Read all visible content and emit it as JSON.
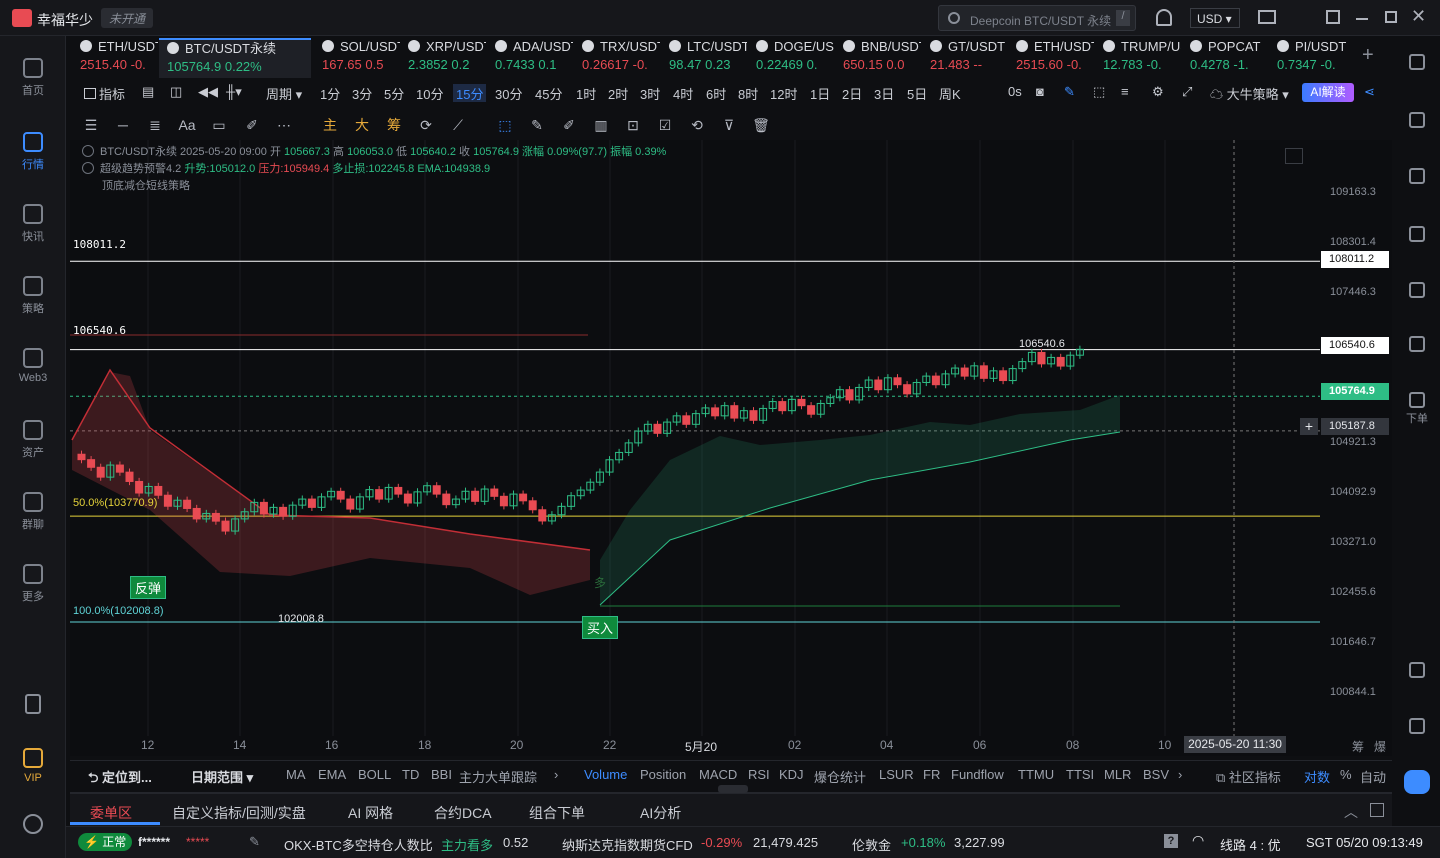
{
  "app": {
    "name": "幸福华少",
    "badge": "未开通",
    "search_placeholder": "Deepcoin BTC/USDT 永续",
    "search_shortcut": "/",
    "currency": "USD"
  },
  "sidebar": [
    {
      "label": "首页",
      "icon": "home-icon"
    },
    {
      "label": "行情",
      "icon": "chart-bar-icon"
    },
    {
      "label": "快讯",
      "icon": "news-icon"
    },
    {
      "label": "策略",
      "icon": "robot-icon"
    },
    {
      "label": "Web3",
      "icon": "web3-icon"
    },
    {
      "label": "资产",
      "icon": "wallet-icon"
    },
    {
      "label": "群聊",
      "icon": "chat-icon"
    },
    {
      "label": "更多",
      "icon": "grid-icon"
    },
    {
      "label": "VIP",
      "icon": "vip-diamond-icon"
    }
  ],
  "tabs": [
    {
      "name": "ETH/USDT",
      "price": "2515.40",
      "change": "-0.",
      "dir": "down"
    },
    {
      "name": "BTC/USDT永续",
      "price": "105764.9",
      "change": "0.22%",
      "dir": "up"
    },
    {
      "name": "SOL/USDT",
      "price": "167.65",
      "change": "0.5",
      "dir": "down"
    },
    {
      "name": "XRP/USDT",
      "price": "2.3852",
      "change": "0.2",
      "dir": "up"
    },
    {
      "name": "ADA/USDT",
      "price": "0.7433",
      "change": "0.1",
      "dir": "up"
    },
    {
      "name": "TRX/USDT",
      "price": "0.26617",
      "change": "-0.",
      "dir": "down"
    },
    {
      "name": "LTC/USDT",
      "price": "98.47",
      "change": "0.23",
      "dir": "up"
    },
    {
      "name": "DOGE/USDT",
      "price": "0.22469",
      "change": "0.",
      "dir": "up"
    },
    {
      "name": "BNB/USDT",
      "price": "650.15",
      "change": "0.0",
      "dir": "down"
    },
    {
      "name": "GT/USDT",
      "price": "21.483",
      "change": "--",
      "dir": "down"
    },
    {
      "name": "ETH/USDT",
      "price": "2515.60",
      "change": "-0.",
      "dir": "down"
    },
    {
      "name": "TRUMP/USDT",
      "price": "12.783",
      "change": "-0.",
      "dir": "up"
    },
    {
      "name": "POPCAT",
      "price": "0.4278",
      "change": "-1.",
      "dir": "up"
    },
    {
      "name": "PI/USDT",
      "price": "0.7347",
      "change": "-0.",
      "dir": "up"
    }
  ],
  "toolbar": {
    "indicators": "指标",
    "period": "周期",
    "periods": [
      "1分",
      "3分",
      "5分",
      "10分",
      "15分",
      "30分",
      "45分",
      "1时",
      "2时",
      "3时",
      "4时",
      "6时",
      "8时",
      "12时",
      "1日",
      "2日",
      "3日",
      "5日",
      "周K"
    ],
    "active_period": "15分",
    "countdown": "0s",
    "strategy": "大牛策略",
    "ai": "AI解读"
  },
  "drawtools": {
    "main": "主",
    "big": "大",
    "chip": "筹"
  },
  "legend": {
    "line1": "BTC/USDT永续 2025-05-20 09:00",
    "open_l": "开",
    "open": "105667.3",
    "high_l": "高",
    "high": "106053.0",
    "low_l": "低",
    "low": "105640.2",
    "close_l": "收",
    "close": "105764.9",
    "chg": "涨幅 0.09%(97.7)",
    "amp": "振幅 0.39%",
    "line2": "超级趋势预警4.2",
    "up": "升势:105012.0",
    "pressure": "压力:105949.4",
    "stop": "多止损:102245.8",
    "ema": "EMA:104938.9",
    "line3": "顶底减仓短线策略"
  },
  "chart_data": {
    "type": "candlestick",
    "symbol": "BTC/USDT永续",
    "interval": "15分",
    "yticks": [
      "109163.3",
      "108301.4",
      "107446.3",
      "106540.6",
      "105764.9",
      "104921.3",
      "104092.9",
      "103271.0",
      "102455.6",
      "101646.7",
      "100844.1"
    ],
    "xticks": [
      "12",
      "14",
      "16",
      "18",
      "20",
      "22",
      "5月20",
      "02",
      "04",
      "06",
      "08",
      "10"
    ],
    "x_time_label": "2025-05-20 11:30",
    "hlines": [
      {
        "label": "108011.2",
        "price": 108011.2,
        "color": "#ffffff"
      },
      {
        "label": "106540.6",
        "price": 106540.6,
        "color": "#ffffff"
      },
      {
        "label": "50.0%(103770.9)",
        "price": 103770.9,
        "color": "#e5d33a"
      },
      {
        "label": "100.0%(102008.8)",
        "price": 102008.8,
        "color": "#5fd3d6"
      }
    ],
    "current_price": "105764.9",
    "crosshair_price": "105187.8",
    "low_marker": "102008.8",
    "high_marker": "106540.6",
    "signals": [
      "反弹",
      "买入"
    ],
    "label_duo": "多",
    "ylim": [
      100844.1,
      109163.3
    ]
  },
  "bottom_tabs": {
    "locate": "定位到...",
    "range": "日期范围",
    "items": [
      "MA",
      "EMA",
      "BOLL",
      "TD",
      "BBI",
      "主力大单跟踪",
      "Volume",
      "Position",
      "MACD",
      "RSI",
      "KDJ",
      "爆仓统计",
      "LSUR",
      "FR",
      "Fundflow",
      "TTMU",
      "TTSI",
      "MLR",
      "BSV"
    ],
    "active": "Volume",
    "community": "社区指标",
    "log": "对数",
    "pct": "%",
    "auto": "自动",
    "right_a": "筹",
    "right_b": "爆"
  },
  "panel_tabs": {
    "items": [
      "委单区",
      "自定义指标/回测/实盘",
      "AI 网格",
      "合约DCA",
      "组合下单",
      "AI分析"
    ],
    "active": "委单区"
  },
  "right_tools": [
    {
      "label": "",
      "icon": "list-icon"
    },
    {
      "label": "",
      "icon": "doc-icon"
    },
    {
      "label": "",
      "icon": "dollar-icon"
    },
    {
      "label": "",
      "icon": "trend-icon"
    },
    {
      "label": "",
      "icon": "monitor-icon"
    },
    {
      "label": "",
      "icon": "card-icon"
    },
    {
      "label": "下单",
      "icon": "swap-icon"
    },
    {
      "label": "",
      "icon": "layout-icon"
    },
    {
      "label": "",
      "icon": "headset-icon"
    }
  ],
  "status": {
    "state": "正常",
    "user": "f******",
    "stars": "*****",
    "ticker1_name": "OKX-BTC多空持仓人数比",
    "ticker1_tag": "主力看多",
    "ticker1_val": "0.52",
    "ticker2_name": "纳斯达克指数期货CFD",
    "ticker2_chg": "-0.29%",
    "ticker2_val": "21,479.425",
    "ticker3_name": "伦敦金",
    "ticker3_chg": "+0.18%",
    "ticker3_val": "3,227.99",
    "line": "线路 4 : 优",
    "time": "SGT 05/20 09:13:49"
  }
}
